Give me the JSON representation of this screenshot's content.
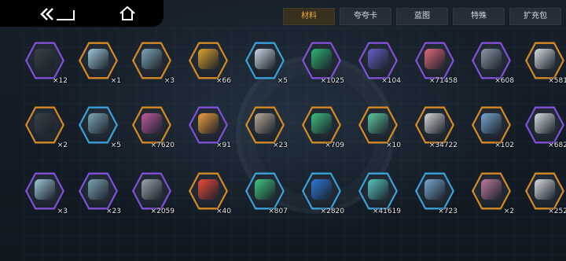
{
  "tabs": [
    {
      "label": "材料",
      "active": true
    },
    {
      "label": "夸夸卡",
      "active": false
    },
    {
      "label": "蓝图",
      "active": false
    },
    {
      "label": "特殊",
      "active": false
    },
    {
      "label": "扩充包",
      "active": false
    }
  ],
  "colors": {
    "gold": "#d38a25",
    "purple": "#8050d8",
    "blue": "#3aa0d8",
    "active_tab": "#f0a63c"
  },
  "rows": [
    [
      {
        "count": "×12",
        "rarity": "purple",
        "icon": "dark-mechanical-parts"
      },
      {
        "count": "×1",
        "rarity": "gold",
        "icon": "battery-canisters"
      },
      {
        "count": "×3",
        "rarity": "gold",
        "icon": "cylinder-rods"
      },
      {
        "count": "×66",
        "rarity": "gold",
        "icon": "gold-medal-coin"
      },
      {
        "count": "×5",
        "rarity": "blue",
        "icon": "spray-bottle"
      },
      {
        "count": "×1025",
        "rarity": "purple",
        "icon": "green-battery-cell"
      },
      {
        "count": "×104",
        "rarity": "purple",
        "icon": "moon-card"
      },
      {
        "count": "×71458",
        "rarity": "purple",
        "icon": "test-tube"
      },
      {
        "count": "×608",
        "rarity": "purple",
        "icon": "metal-chip-plate"
      },
      {
        "count": "×581",
        "rarity": "gold",
        "icon": "cloud-fabric"
      }
    ],
    [
      {
        "count": "×2",
        "rarity": "gold",
        "icon": "dark-mechanical-parts"
      },
      {
        "count": "×5",
        "rarity": "blue",
        "icon": "cylinder-rods"
      },
      {
        "count": "×7620",
        "rarity": "gold",
        "icon": "mixed-cubes"
      },
      {
        "count": "×91",
        "rarity": "purple",
        "icon": "heart-badge"
      },
      {
        "count": "×23",
        "rarity": "gold",
        "icon": "stone-cubes"
      },
      {
        "count": "×709",
        "rarity": "gold",
        "icon": "green-power-box"
      },
      {
        "count": "×10",
        "rarity": "gold",
        "icon": "circuit-board"
      },
      {
        "count": "×34722",
        "rarity": "gold",
        "icon": "wrench-tool"
      },
      {
        "count": "×102",
        "rarity": "gold",
        "icon": "honeycomb-plate"
      },
      {
        "count": "×682",
        "rarity": "purple",
        "icon": "cloud-fabric"
      }
    ],
    [
      {
        "count": "×3",
        "rarity": "purple",
        "icon": "battery-canisters"
      },
      {
        "count": "×23",
        "rarity": "purple",
        "icon": "cylinder-rods"
      },
      {
        "count": "×2059",
        "rarity": "purple",
        "icon": "metal-card"
      },
      {
        "count": "×40",
        "rarity": "gold",
        "icon": "star-burst"
      },
      {
        "count": "×807",
        "rarity": "blue",
        "icon": "green-orb-device"
      },
      {
        "count": "×2820",
        "rarity": "blue",
        "icon": "blue-chip-card"
      },
      {
        "count": "×41619",
        "rarity": "blue",
        "icon": "robot-arm"
      },
      {
        "count": "×723",
        "rarity": "blue",
        "icon": "honeycomb-plate"
      },
      {
        "count": "×2",
        "rarity": "gold",
        "icon": "honeycomb-plate-small"
      },
      {
        "count": "×252",
        "rarity": "gold",
        "icon": "cloud-fabric"
      }
    ]
  ]
}
